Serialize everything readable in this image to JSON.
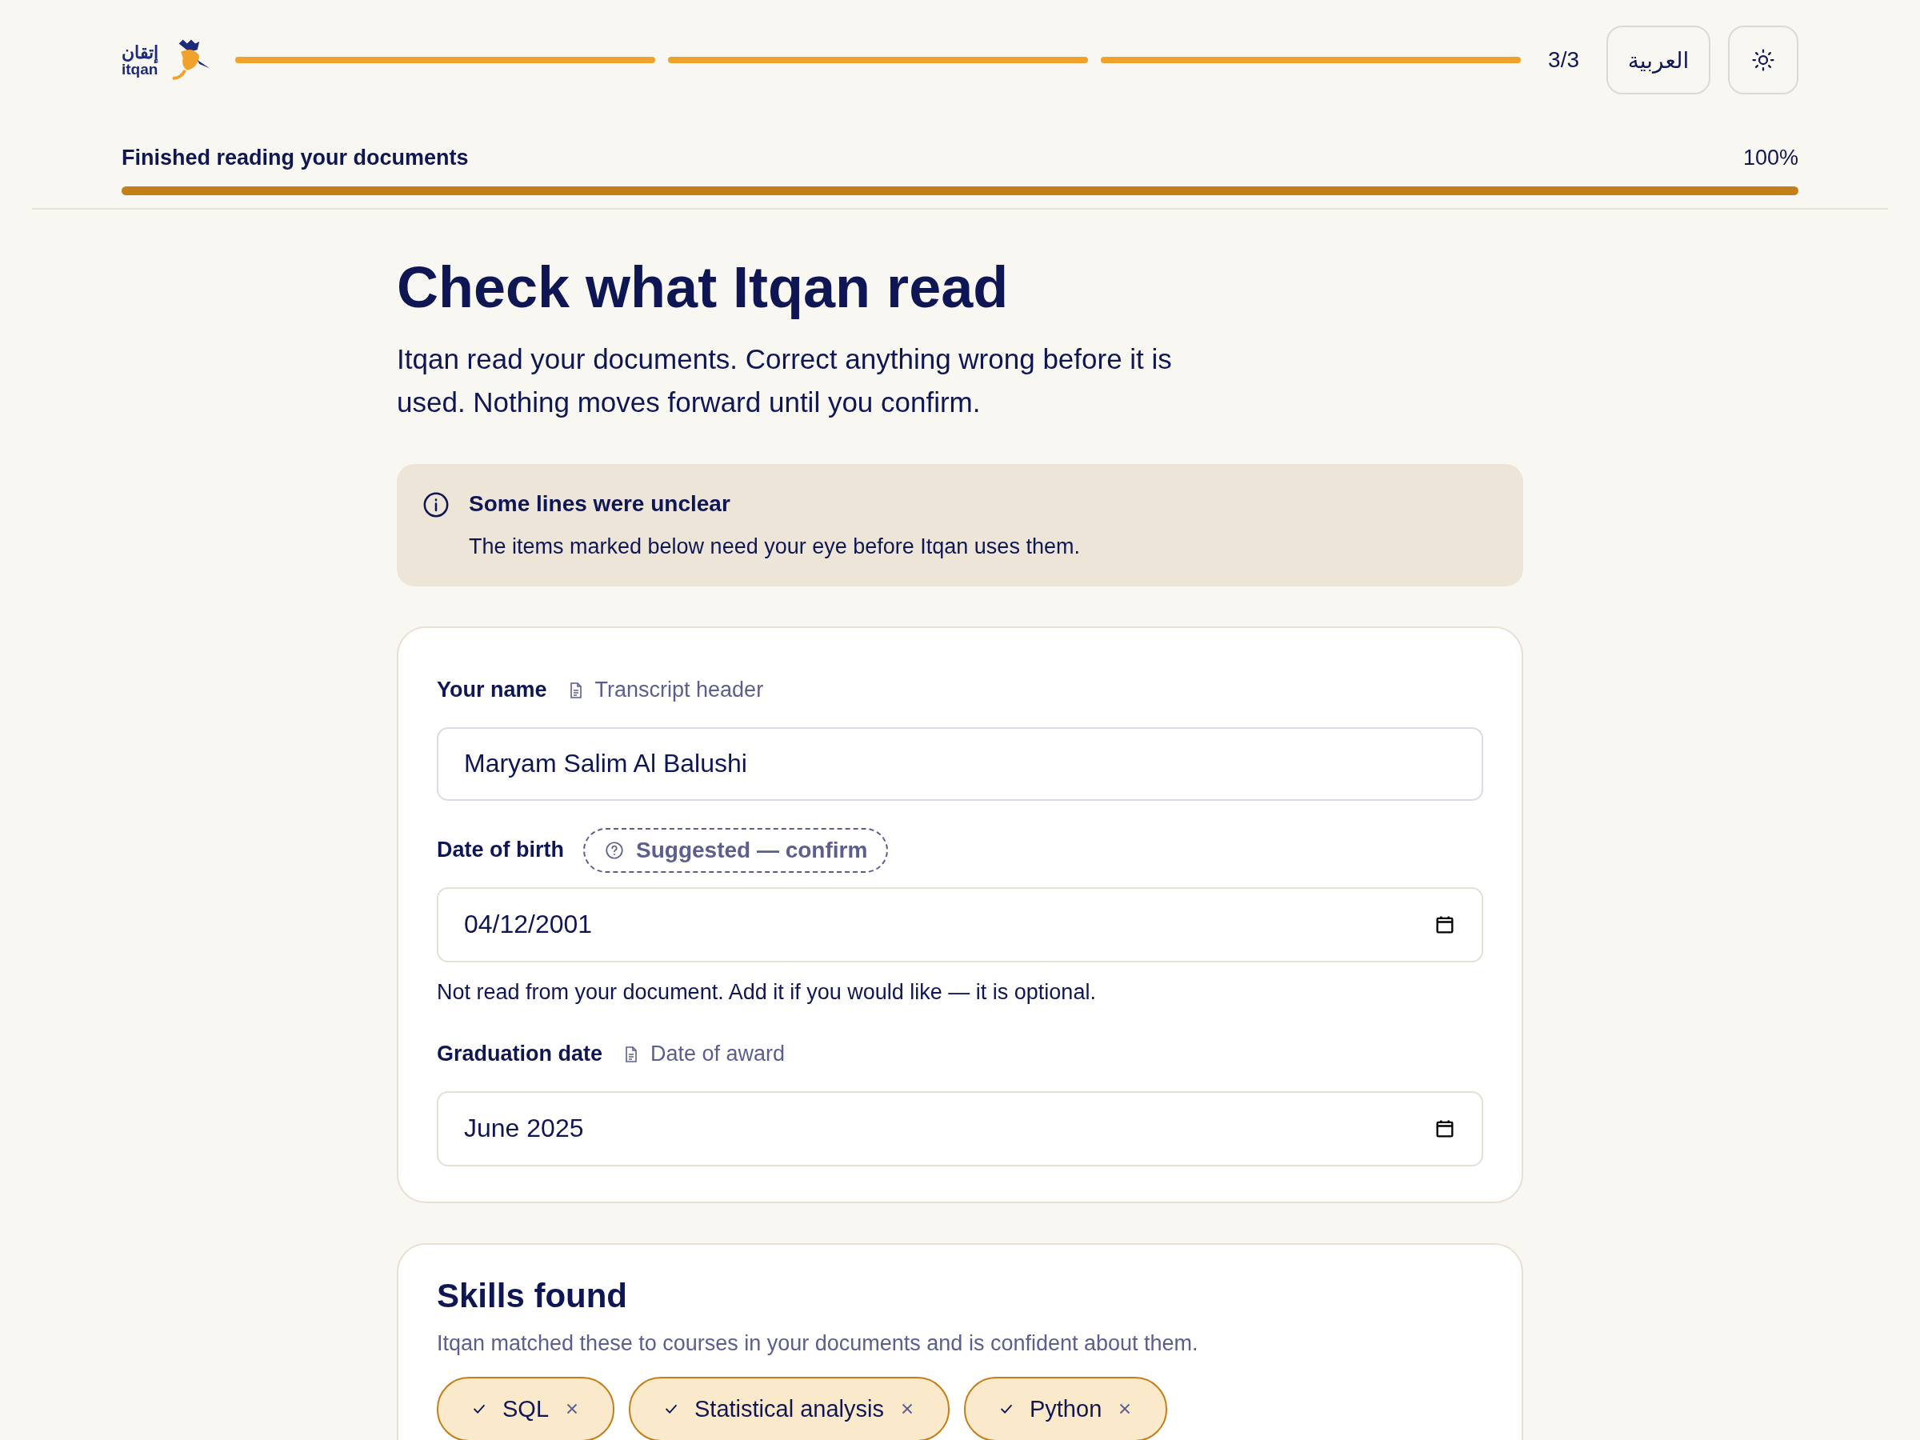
{
  "header": {
    "logo": {
      "arabic": "إتقان",
      "latin": "itqan"
    },
    "steps": [
      {
        "done": true
      },
      {
        "done": true
      },
      {
        "done": true
      }
    ],
    "step_count": "3/3",
    "language_button": "العربية"
  },
  "progress": {
    "label": "Finished reading your documents",
    "reading": "100%",
    "level": 1
  },
  "title": "Check what Itqan read",
  "intro": "Itqan read your documents. Correct anything wrong before it is used. Nothing moves forward until you confirm.",
  "alert": {
    "title": "Some lines were unclear",
    "text": "The items marked below need your eye before Itqan uses them."
  },
  "fields": [
    {
      "label": "Your name",
      "kind": "text",
      "source": "Transcript header",
      "value": "Maryam Salim Al Balushi"
    },
    {
      "label": "Date of birth",
      "kind": "date",
      "badge": "Suggested — confirm",
      "value": "04/12/2001",
      "hint": "Not read from your document. Add it if you would like — it is optional."
    },
    {
      "label": "Graduation date",
      "kind": "date",
      "source": "Date of award",
      "value": "June 2025"
    }
  ],
  "skills": {
    "title": "Skills found",
    "text": "Itqan matched these to courses in your documents and is confident about them.",
    "chips": [
      "SQL",
      "Statistical analysis",
      "Python"
    ]
  }
}
